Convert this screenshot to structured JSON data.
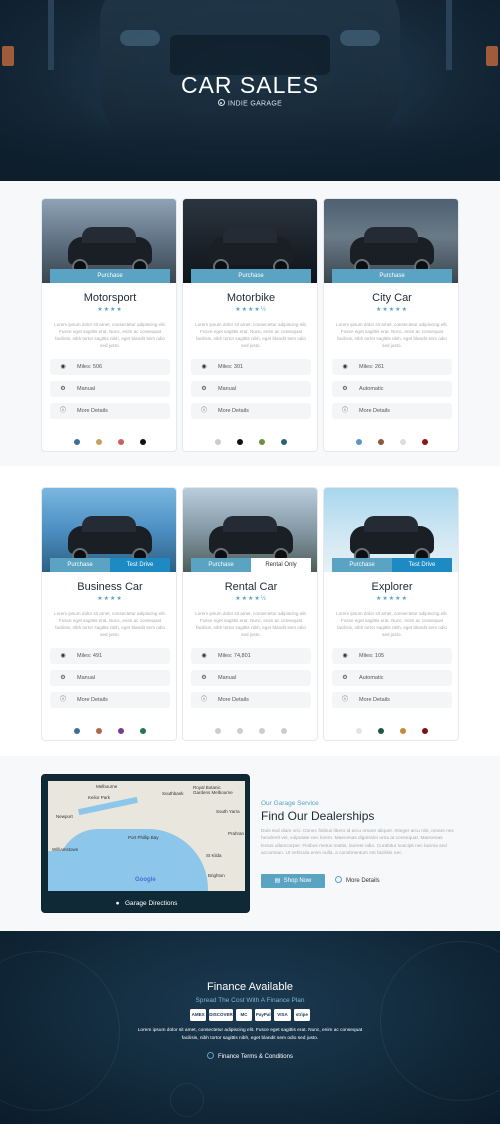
{
  "hero": {
    "title": "CAR SALES",
    "subtitle": "INDIE GARAGE"
  },
  "cars": [
    {
      "title": "Motorsport",
      "stars": "★★★★",
      "buttons": [
        "Purchase"
      ],
      "desc": "Lorem ipsum dolor sit amet, consectetur adipiscing elit. Fusce eget sagittis erat. Nunc, enim ac consequat facilisis, nibh tortor sagittis nibh, eget blandit sem odio sed justo.",
      "specs": [
        "Miles: 506",
        "Manual",
        "More Details"
      ],
      "swatches": [
        "#3e6f97",
        "#c4a35a",
        "#c76060",
        "#111111"
      ]
    },
    {
      "title": "Motorbike",
      "stars": "★★★★½",
      "buttons": [
        "Purchase"
      ],
      "desc": "Lorem ipsum dolor sit amet, consectetur adipiscing elit. Fusce eget sagittis erat. Nunc, enim ac consequat facilisis, nibh tortor sagittis nibh, eget blandit sem odio sed justo.",
      "specs": [
        "Miles: 301",
        "Manual",
        "More Details"
      ],
      "swatches": [
        "#cccccc",
        "#111111",
        "#6d8f3e",
        "#2d5f7d"
      ]
    },
    {
      "title": "City Car",
      "stars": "★★★★★",
      "buttons": [
        "Purchase"
      ],
      "desc": "Lorem ipsum dolor sit amet, consectetur adipiscing elit. Fusce eget sagittis erat. Nunc, enim ac consequat facilisis, nibh tortor sagittis nibh, eget blandit sem odio sed justo.",
      "specs": [
        "Miles: 261",
        "Automatic",
        "More Details"
      ],
      "swatches": [
        "#5f93c2",
        "#8a5a3d",
        "#dddddd",
        "#8a1515"
      ]
    },
    {
      "title": "Business Car",
      "stars": "★★★★",
      "buttons": [
        "Purchase",
        "Test Drive"
      ],
      "desc": "Lorem ipsum dolor sit amet, consectetur adipiscing elit. Fusce eget sagittis erat. Nunc, enim ac consequat facilisis, nibh tortor sagittis nibh, eget blandit sem odio sed justo.",
      "specs": [
        "Miles: 491",
        "Manual",
        "More Details"
      ],
      "swatches": [
        "#3e6f97",
        "#b5654a",
        "#7a3a8f",
        "#1e7a4a"
      ]
    },
    {
      "title": "Rental Car",
      "stars": "★★★★½",
      "buttons": [
        "Purchase",
        "Rental Only"
      ],
      "desc": "Lorem ipsum dolor sit amet, consectetur adipiscing elit. Fusce eget sagittis erat. Nunc, enim ac consequat facilisis, nibh tortor sagittis nibh, eget blandit sem odio sed justo.",
      "specs": [
        "Miles: 74,801",
        "Manual",
        "More Details"
      ],
      "swatches": [
        "#cccccc",
        "#cccccc",
        "#cccccc",
        "#cccccc"
      ]
    },
    {
      "title": "Explorer",
      "stars": "★★★★★",
      "buttons": [
        "Purchase",
        "Test Drive"
      ],
      "desc": "Lorem ipsum dolor sit amet, consectetur adipiscing elit. Fusce eget sagittis erat. Nunc, enim ac consequat facilisis, nibh tortor sagittis nibh, eget blandit sem odio sed justo.",
      "specs": [
        "Miles: 105",
        "Automatic",
        "More Details"
      ],
      "swatches": [
        "#e5e5e5",
        "#1e5a3a",
        "#c28a3a",
        "#7a1010"
      ]
    }
  ],
  "dealership": {
    "kicker": "Our Garage Service",
    "title": "Find Our Dealerships",
    "desc": "Duis sed diam orci. Donec finibus libero id arcu ornare aliquet. Integer arcu nisi, ornare nec hendrerit vel, vulputate nec lorem. Maecenas dignissim urna at consequat. Maecenas lectus ullamcorper. Finibus metus mattis, laoreet odio. Curabitur suscipit nec lacinia sed accumsan. Ut vehicula enim nulla, a condimentum est facilisis nec.",
    "shop_label": "Shop Now",
    "more_label": "More Details",
    "map_button": "Garage Directions",
    "map_labels": [
      "Melbourne",
      "Keilor Park",
      "Newport",
      "Williamstown",
      "Southbank",
      "Royal Botanic Gardens Melbourne",
      "South Yarra",
      "Prahran",
      "St Kilda",
      "Port Phillip Bay",
      "Brighton"
    ],
    "google": "Google"
  },
  "footer": {
    "title": "Finance Available",
    "subtitle": "Spread The Cost With A Finance Plan",
    "payments": [
      "AMEX",
      "DISCOVER",
      "MC",
      "PayPal",
      "VISA",
      "stripe"
    ],
    "desc": "Lorem ipsum dolor sit amet, consectetur adipiscing elit. Fusce eget sagittis erat. Nunc, enim ac consequat facilisis, nibh tortor sagittis nibh, eget blandit sem odio sed justo.",
    "terms": "Finance Terms & Conditions"
  },
  "colors": {
    "accent": "#5aa3c2",
    "accent_dark": "#1d8ac4",
    "hero_bg": "#15293a",
    "footer_bg": "#122a3c"
  }
}
